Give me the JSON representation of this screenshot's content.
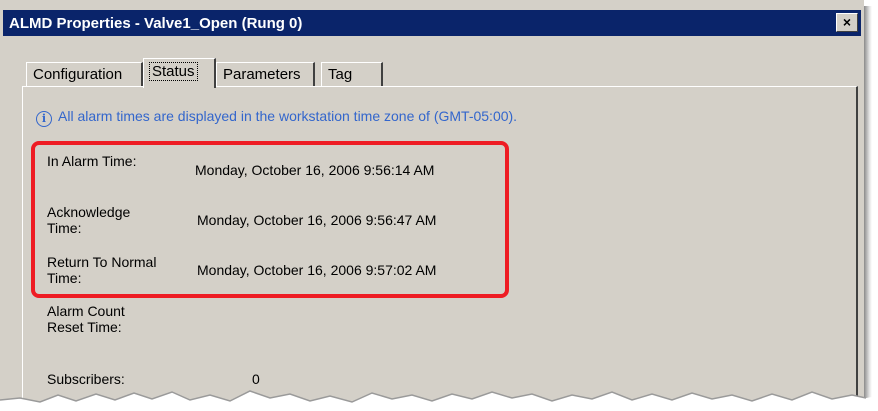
{
  "window": {
    "title": "ALMD Properties - Valve1_Open (Rung 0)",
    "close_label": "×"
  },
  "tabs": [
    {
      "label": "Configuration",
      "active": false
    },
    {
      "label": "Status",
      "active": true
    },
    {
      "label": "Parameters",
      "active": false
    },
    {
      "label": "Tag",
      "active": false
    }
  ],
  "status": {
    "info_icon": "info-icon",
    "info_text": "All alarm times are displayed in the workstation time zone of (GMT-05:00).",
    "fields": [
      {
        "label": "In Alarm Time:",
        "value": "Monday, October 16, 2006 9:56:14 AM"
      },
      {
        "label": "Acknowledge Time:",
        "value": "Monday, October 16, 2006 9:56:47 AM"
      },
      {
        "label": "Return To Normal Time:",
        "value": "Monday, October 16, 2006 9:57:02 AM"
      },
      {
        "label": "Alarm Count Reset Time:",
        "value": ""
      },
      {
        "label": "Subscribers:",
        "value": "0"
      }
    ]
  },
  "colors": {
    "title_bar": "#0a246a",
    "dialog_bg": "#d4d0c8",
    "info_text": "#3366cc",
    "highlight_box": "#ee1c24"
  }
}
